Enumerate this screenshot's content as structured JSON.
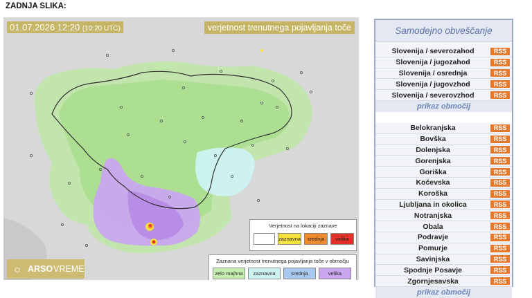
{
  "header": {
    "title": "ZADNJA SLIKA:"
  },
  "map": {
    "timestamp": "01.07.2026 12:20",
    "timestamp_utc": "(10:20 UTC)",
    "product_title": "verjetnost trenutnega pojavljanja toče",
    "brand_strong": "ARSO",
    "brand_light": "VREME",
    "legend_location": {
      "title": "Verjetnost na lokaciji zaznave",
      "items": [
        {
          "label": "",
          "color": "#ffffff"
        },
        {
          "label": "zaznavna",
          "color": "#f6e23e"
        },
        {
          "label": "srednja",
          "color": "#ee8a2d"
        },
        {
          "label": "velika",
          "color": "#e03027"
        }
      ]
    },
    "legend_area": {
      "title": "Zaznana verjetnost trenutnega pojavljanja toče v območju",
      "items": [
        {
          "label": "zelo majhna",
          "color": "#c6eeb0"
        },
        {
          "label": "zaznavna",
          "color": "#cdf2f2"
        },
        {
          "label": "srednja",
          "color": "#a9c8ee"
        },
        {
          "label": "velika",
          "color": "#c9a6ee"
        }
      ]
    }
  },
  "panel": {
    "title": "Samodejno obveščanje",
    "rss_label": "RSS",
    "regions": [
      "Slovenija / severozahod",
      "Slovenija / jugozahod",
      "Slovenija / osrednja",
      "Slovenija / jugovzhod",
      "Slovenija / severovzhod"
    ],
    "regions_link": "prikaz območij",
    "areas": [
      "Belokranjska",
      "Bovška",
      "Dolenjska",
      "Gorenjska",
      "Goriška",
      "Kočevska",
      "Koroška",
      "Ljubljana in okolica",
      "Notranjska",
      "Obala",
      "Podravje",
      "Pomurje",
      "Savinjska",
      "Spodnje Posavje",
      "Zgornjesavska"
    ],
    "areas_link": "prikaz območij"
  }
}
